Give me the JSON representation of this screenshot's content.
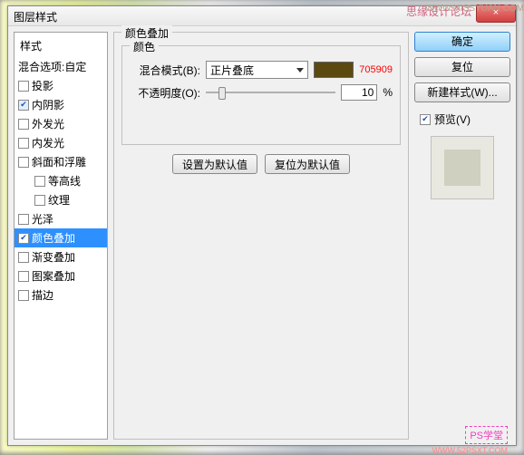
{
  "watermarks": {
    "top_text": "思缘设计论坛",
    "top_url": "WWW.MISSYUAN.COM",
    "bottom_text": "PS学堂",
    "bottom_url": "WWW.52PSXT.COM"
  },
  "window": {
    "title": "图层样式",
    "close": "×"
  },
  "sidebar": {
    "header": "样式",
    "blend_options": "混合选项:自定",
    "items": [
      {
        "label": "投影",
        "checked": false
      },
      {
        "label": "内阴影",
        "checked": true
      },
      {
        "label": "外发光",
        "checked": false
      },
      {
        "label": "内发光",
        "checked": false
      },
      {
        "label": "斜面和浮雕",
        "checked": false
      },
      {
        "label": "等高线",
        "checked": false,
        "indent": true
      },
      {
        "label": "纹理",
        "checked": false,
        "indent": true
      },
      {
        "label": "光泽",
        "checked": false
      },
      {
        "label": "颜色叠加",
        "checked": true,
        "selected": true
      },
      {
        "label": "渐变叠加",
        "checked": false
      },
      {
        "label": "图案叠加",
        "checked": false
      },
      {
        "label": "描边",
        "checked": false
      }
    ]
  },
  "panel": {
    "group_title": "颜色叠加",
    "inner_title": "颜色",
    "blend_mode_label": "混合模式(B):",
    "blend_mode_value": "正片叠底",
    "color_hex": "705909",
    "opacity_label": "不透明度(O):",
    "opacity_value": "10",
    "opacity_unit": "%",
    "btn_default": "设置为默认值",
    "btn_reset": "复位为默认值"
  },
  "right": {
    "ok": "确定",
    "cancel": "复位",
    "new_style": "新建样式(W)...",
    "preview_label": "预览(V)"
  }
}
